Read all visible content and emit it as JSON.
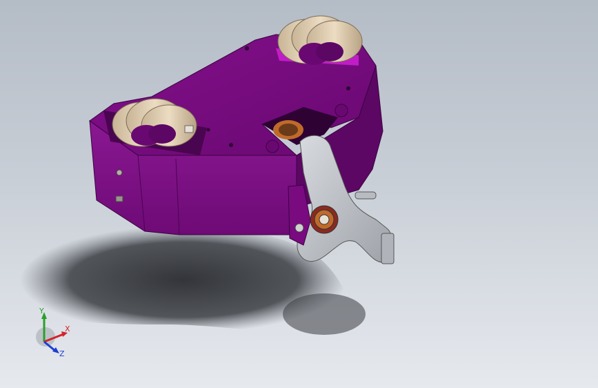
{
  "viewport": {
    "background_top": "#b4bcc6",
    "background_bottom": "#e6e9ee"
  },
  "model": {
    "body_color": "#7a0a80",
    "body_shade": "#5c0764",
    "wheel_color": "#d9c8ad",
    "bracket_color": "#c9ccd1",
    "bearing_color": "#c06a2a"
  },
  "triad": {
    "x_label": "X",
    "y_label": "Y",
    "z_label": "Z",
    "x_color": "#d2232a",
    "y_color": "#2aa02a",
    "z_color": "#1c3fd0"
  }
}
